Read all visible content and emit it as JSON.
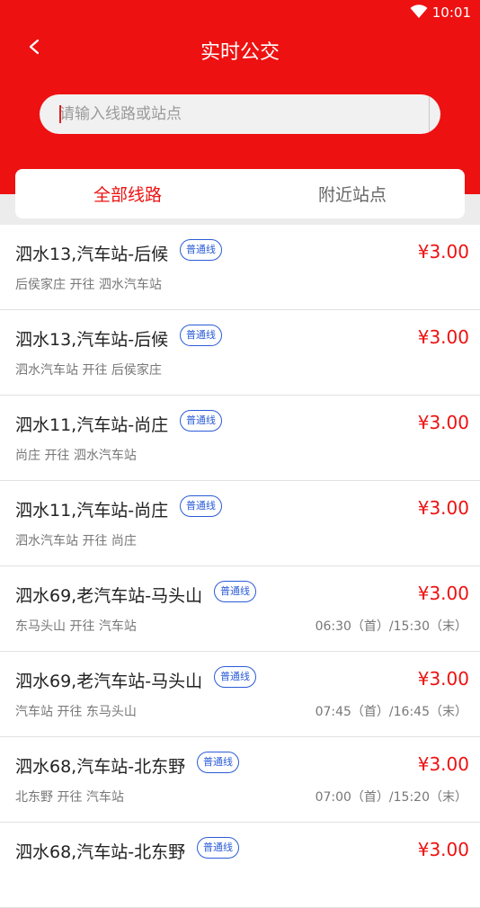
{
  "status": {
    "time": "10:01",
    "wifi_icon": "wifi-icon"
  },
  "header": {
    "title": "实时公交",
    "back_icon": "back-arrow-icon"
  },
  "search": {
    "placeholder": "请输入线路或站点",
    "value": "",
    "icon": "search-icon"
  },
  "tabs": [
    {
      "label": "全部线路",
      "active": true
    },
    {
      "label": "附近站点",
      "active": false
    }
  ],
  "routes": [
    {
      "name": "泗水13,汽车站-后候",
      "badge": "普通线",
      "price": "¥3.00",
      "direction": "后侯家庄 开往 泗水汽车站",
      "time": ""
    },
    {
      "name": "泗水13,汽车站-后候",
      "badge": "普通线",
      "price": "¥3.00",
      "direction": "泗水汽车站 开往 后侯家庄",
      "time": ""
    },
    {
      "name": "泗水11,汽车站-尚庄",
      "badge": "普通线",
      "price": "¥3.00",
      "direction": "尚庄 开往 泗水汽车站",
      "time": ""
    },
    {
      "name": "泗水11,汽车站-尚庄",
      "badge": "普通线",
      "price": "¥3.00",
      "direction": "泗水汽车站 开往 尚庄",
      "time": ""
    },
    {
      "name": "泗水69,老汽车站-马头山",
      "badge": "普通线",
      "price": "¥3.00",
      "direction": "东马头山 开往 汽车站",
      "time": "06:30（首）/15:30（末）"
    },
    {
      "name": "泗水69,老汽车站-马头山",
      "badge": "普通线",
      "price": "¥3.00",
      "direction": "汽车站 开往 东马头山",
      "time": "07:45（首）/16:45（末）"
    },
    {
      "name": "泗水68,汽车站-北东野",
      "badge": "普通线",
      "price": "¥3.00",
      "direction": "北东野 开往 汽车站",
      "time": "07:00（首）/15:20（末）"
    },
    {
      "name": "泗水68,汽车站-北东野",
      "badge": "普通线",
      "price": "¥3.00",
      "direction": "",
      "time": ""
    }
  ],
  "colors": {
    "brand": "#ee1111",
    "badge": "#2a5bd7"
  }
}
